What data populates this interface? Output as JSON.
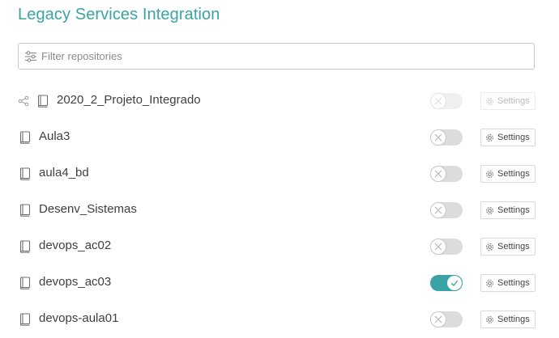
{
  "page": {
    "title": "Legacy Services Integration"
  },
  "search": {
    "placeholder": "Filter repositories",
    "value": ""
  },
  "colors": {
    "accent": "#3aa3a5",
    "toggle_off": "#dcdcdc"
  },
  "icons": {
    "filter": "filter-sliders-icon",
    "share": "share-icon",
    "repo": "book-repo-icon",
    "settings": "gear-icon",
    "off": "x-icon",
    "on": "check-icon"
  },
  "repositories": [
    {
      "name": "2020_2_Projeto_Integrado",
      "shared": true,
      "enabled": false,
      "disabled": true,
      "settings_label": "Settings"
    },
    {
      "name": "Aula3",
      "shared": false,
      "enabled": false,
      "disabled": false,
      "settings_label": "Settings"
    },
    {
      "name": "aula4_bd",
      "shared": false,
      "enabled": false,
      "disabled": false,
      "settings_label": "Settings"
    },
    {
      "name": "Desenv_Sistemas",
      "shared": false,
      "enabled": false,
      "disabled": false,
      "settings_label": "Settings"
    },
    {
      "name": "devops_ac02",
      "shared": false,
      "enabled": false,
      "disabled": false,
      "settings_label": "Settings"
    },
    {
      "name": "devops_ac03",
      "shared": false,
      "enabled": true,
      "disabled": false,
      "settings_label": "Settings"
    },
    {
      "name": "devops-aula01",
      "shared": false,
      "enabled": false,
      "disabled": false,
      "settings_label": "Settings"
    }
  ]
}
